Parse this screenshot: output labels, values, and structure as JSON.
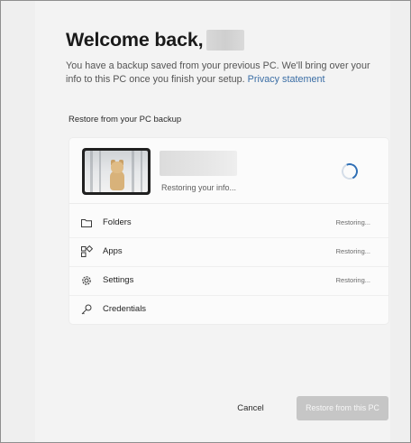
{
  "header": {
    "title": "Welcome back,",
    "description": "You have a backup saved from your previous PC. We'll bring over your info to this PC once you finish your setup.",
    "privacy_link": "Privacy statement"
  },
  "section": {
    "label": "Restore from your PC backup"
  },
  "device": {
    "status": "Restoring your info..."
  },
  "items": [
    {
      "label": "Folders",
      "status": "Restoring...",
      "icon": "folder-icon"
    },
    {
      "label": "Apps",
      "status": "Restoring...",
      "icon": "apps-icon"
    },
    {
      "label": "Settings",
      "status": "Restoring...",
      "icon": "gear-icon"
    },
    {
      "label": "Credentials",
      "status": "",
      "icon": "key-icon"
    }
  ],
  "footer": {
    "cancel_label": "Cancel",
    "restore_label": "Restore from this PC"
  },
  "colors": {
    "accent": "#2f6fb5",
    "link": "#3b6ea5",
    "disabled_button": "#c6c6c6"
  }
}
